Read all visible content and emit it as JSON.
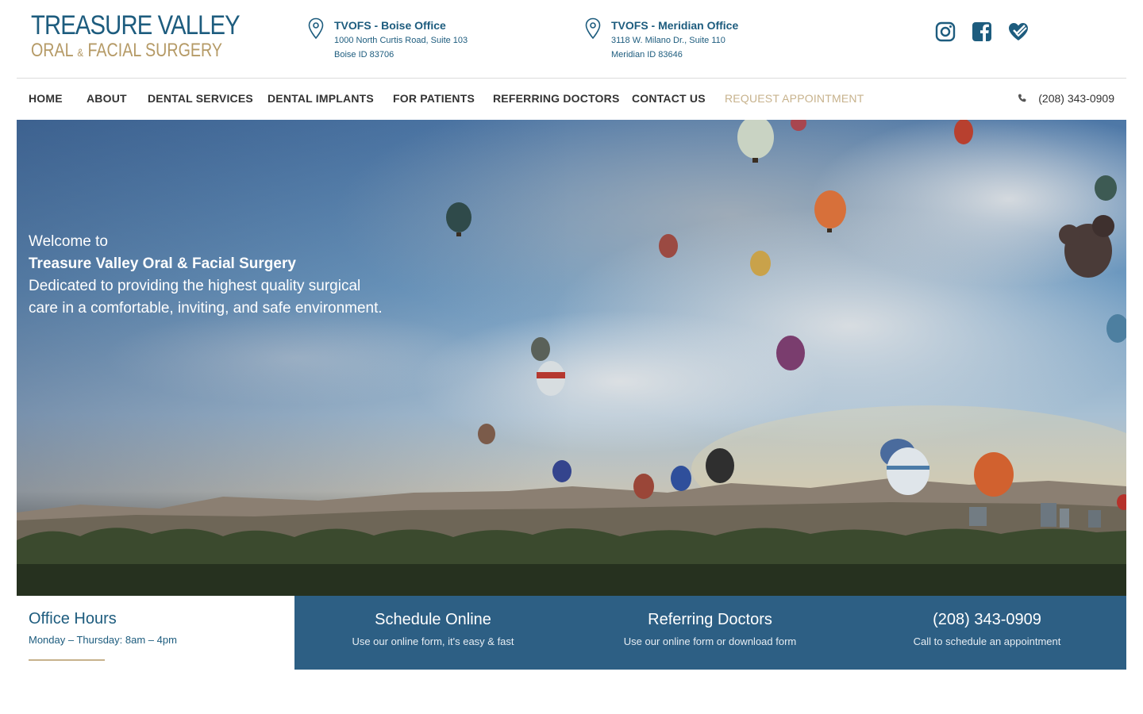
{
  "logo": {
    "line1": "TREASURE VALLEY",
    "line2_a": "ORAL",
    "line2_amp": "&",
    "line2_b": "FACIAL SURGERY"
  },
  "offices": [
    {
      "title": "TVOFS - Boise Office",
      "address": "1000 North Curtis Road, Suite 103",
      "city": "Boise ID 83706",
      "icon": "map-pin-icon"
    },
    {
      "title": "TVOFS - Meridian Office",
      "address": "3118 W. Milano Dr., Suite 110",
      "city": "Meridian ID 83646",
      "icon": "map-pin-icon"
    }
  ],
  "social": [
    {
      "name": "instagram-icon"
    },
    {
      "name": "facebook-icon"
    },
    {
      "name": "healthgrades-icon"
    }
  ],
  "nav": {
    "items": [
      "HOME",
      "ABOUT",
      "DENTAL SERVICES",
      "DENTAL IMPLANTS",
      "FOR PATIENTS",
      "REFERRING DOCTORS",
      "CONTACT US"
    ],
    "cta": "REQUEST APPOINTMENT",
    "phone": "(208) 343-0909"
  },
  "hero": {
    "welcome": "Welcome to",
    "name": "Treasure Valley Oral & Facial Surgery",
    "tagline": "Dedicated to providing the highest quality surgical care in a comfortable, inviting, and safe environment."
  },
  "hours": {
    "title": "Office Hours",
    "line": "Monday – Thursday: 8am – 4pm"
  },
  "ctas": [
    {
      "title": "Schedule Online",
      "sub": "Use our online form, it's easy & fast"
    },
    {
      "title": "Referring Doctors",
      "sub": "Use our online form or download form"
    },
    {
      "title": "(208) 343-0909",
      "sub": "Call to schedule an appointment"
    }
  ],
  "colors": {
    "brand_blue": "#1d5c7e",
    "brand_gold": "#b59a66",
    "cta_bar": "#2d5f84"
  }
}
